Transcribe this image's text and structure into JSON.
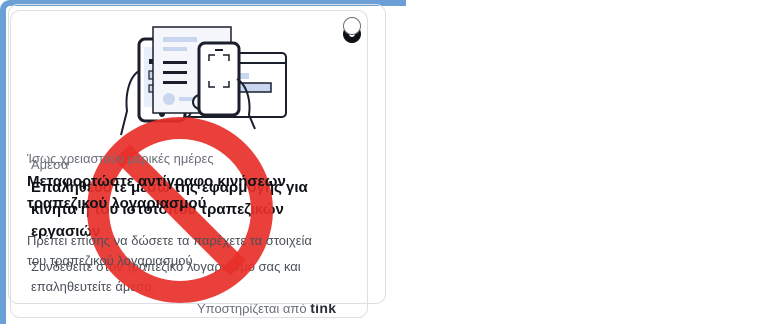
{
  "option_instant": {
    "eyebrow": "Άμεσα",
    "title_line1": "Επαληθεύστε μέσω της εφαρμογής για",
    "title_line2": "κινητά ή του ιστότοπου τραπεζικών",
    "title_line3": "εργασιών",
    "desc_line1": "Συνδεθείτε στον τραπεζικό λογαριασμό σας και",
    "desc_line2": "επαληθευτείτε άμεσα.",
    "powered_by": "Υποστηρίζεται από",
    "powered_brand": "tink",
    "selected": true
  },
  "option_upload": {
    "eyebrow": "Ίσως χρειαστούν μερικές ημέρες",
    "title_line1": "Μεταφορτώστε αντίγραφο κινήσεων",
    "title_line2": "τραπεζικού λογαριασμού",
    "desc_line1": "Πρέπει επίσης να δώσετε τα παρέχετε τα στοιχεία",
    "desc_line2": "του τραπεζικού λογαριασμού.",
    "selected": false
  },
  "icons": {
    "illustration_a": "phone-and-browser-icon",
    "illustration_b": "phone-scanning-document-icon",
    "overlay": "prohibited-sign-icon"
  },
  "colors": {
    "accent": "#6aa0d6",
    "text": "#0e1116",
    "muted": "#6a6f78",
    "prohibit_red": "#e8302a"
  }
}
